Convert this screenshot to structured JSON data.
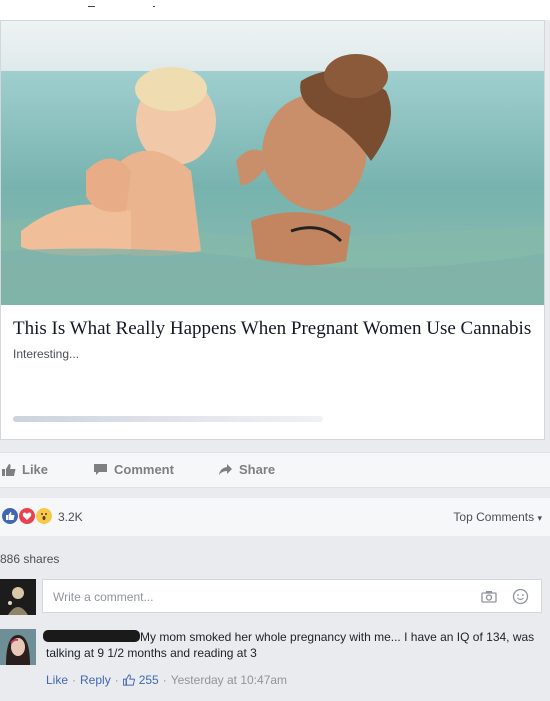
{
  "card": {
    "headline": "This Is What Really Happens When Pregnant Women Use Cannabis",
    "subtitle": "Interesting..."
  },
  "actions": {
    "like": "Like",
    "comment": "Comment",
    "share": "Share"
  },
  "reactions": {
    "count": "3.2K",
    "top_comments": "Top Comments",
    "icons": [
      "like-icon",
      "love-icon",
      "wow-icon"
    ]
  },
  "shares": "886 shares",
  "comment_box": {
    "placeholder": "Write a comment...",
    "icons": [
      "camera-icon",
      "emoji-icon"
    ]
  },
  "comment": {
    "text": "My mom smoked her whole pregnancy with me... I have an IQ of 134, was talking at 9 1/2 months and reading at 3",
    "like": "Like",
    "reply": "Reply",
    "like_count": "255",
    "time": "Yesterday at 10:47am",
    "separator": "·"
  },
  "colors": {
    "facebook_blue": "#4267b2",
    "love_red": "#e9414f",
    "wow_yellow": "#f7c94a"
  }
}
